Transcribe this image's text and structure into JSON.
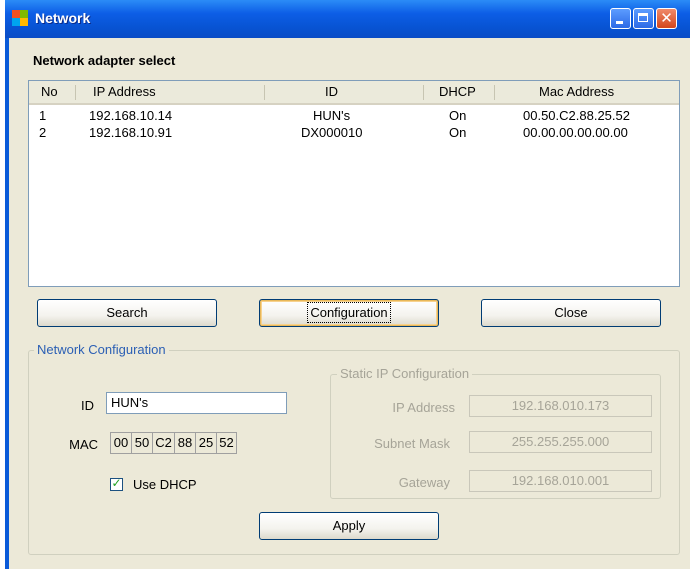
{
  "window": {
    "title": "Network",
    "close_glyph": "✕"
  },
  "adapter_select": {
    "title": "Network adapter select"
  },
  "list": {
    "columns": [
      "No",
      "IP Address",
      "ID",
      "DHCP",
      "Mac Address"
    ],
    "rows": [
      {
        "no": "1",
        "ip": "192.168.10.14",
        "id": "HUN's",
        "dhcp": "On",
        "mac": "00.50.C2.88.25.52"
      },
      {
        "no": "2",
        "ip": "192.168.10.91",
        "id": "DX000010",
        "dhcp": "On",
        "mac": "00.00.00.00.00.00"
      }
    ]
  },
  "buttons": {
    "search": "Search",
    "configuration": "Configuration",
    "close": "Close",
    "apply": "Apply"
  },
  "network_config": {
    "title": "Network Configuration",
    "id_label": "ID",
    "id_value": "HUN's",
    "mac_label": "MAC",
    "mac_octets": [
      "00",
      "50",
      "C2",
      "88",
      "25",
      "52"
    ],
    "use_dhcp_label": "Use DHCP",
    "use_dhcp_checked": true
  },
  "static_ip": {
    "title": "Static IP Configuration",
    "ip_label": "IP Address",
    "ip_value": "192.168.010.173",
    "subnet_label": "Subnet Mask",
    "subnet_value": "255.255.255.000",
    "gateway_label": "Gateway",
    "gateway_value": "192.168.010.001"
  },
  "colors": {
    "title_bar": "#0a5ad8",
    "window_bg": "#ece9d8",
    "list_border": "#7f9db9",
    "disabled_text": "#a6a498"
  }
}
